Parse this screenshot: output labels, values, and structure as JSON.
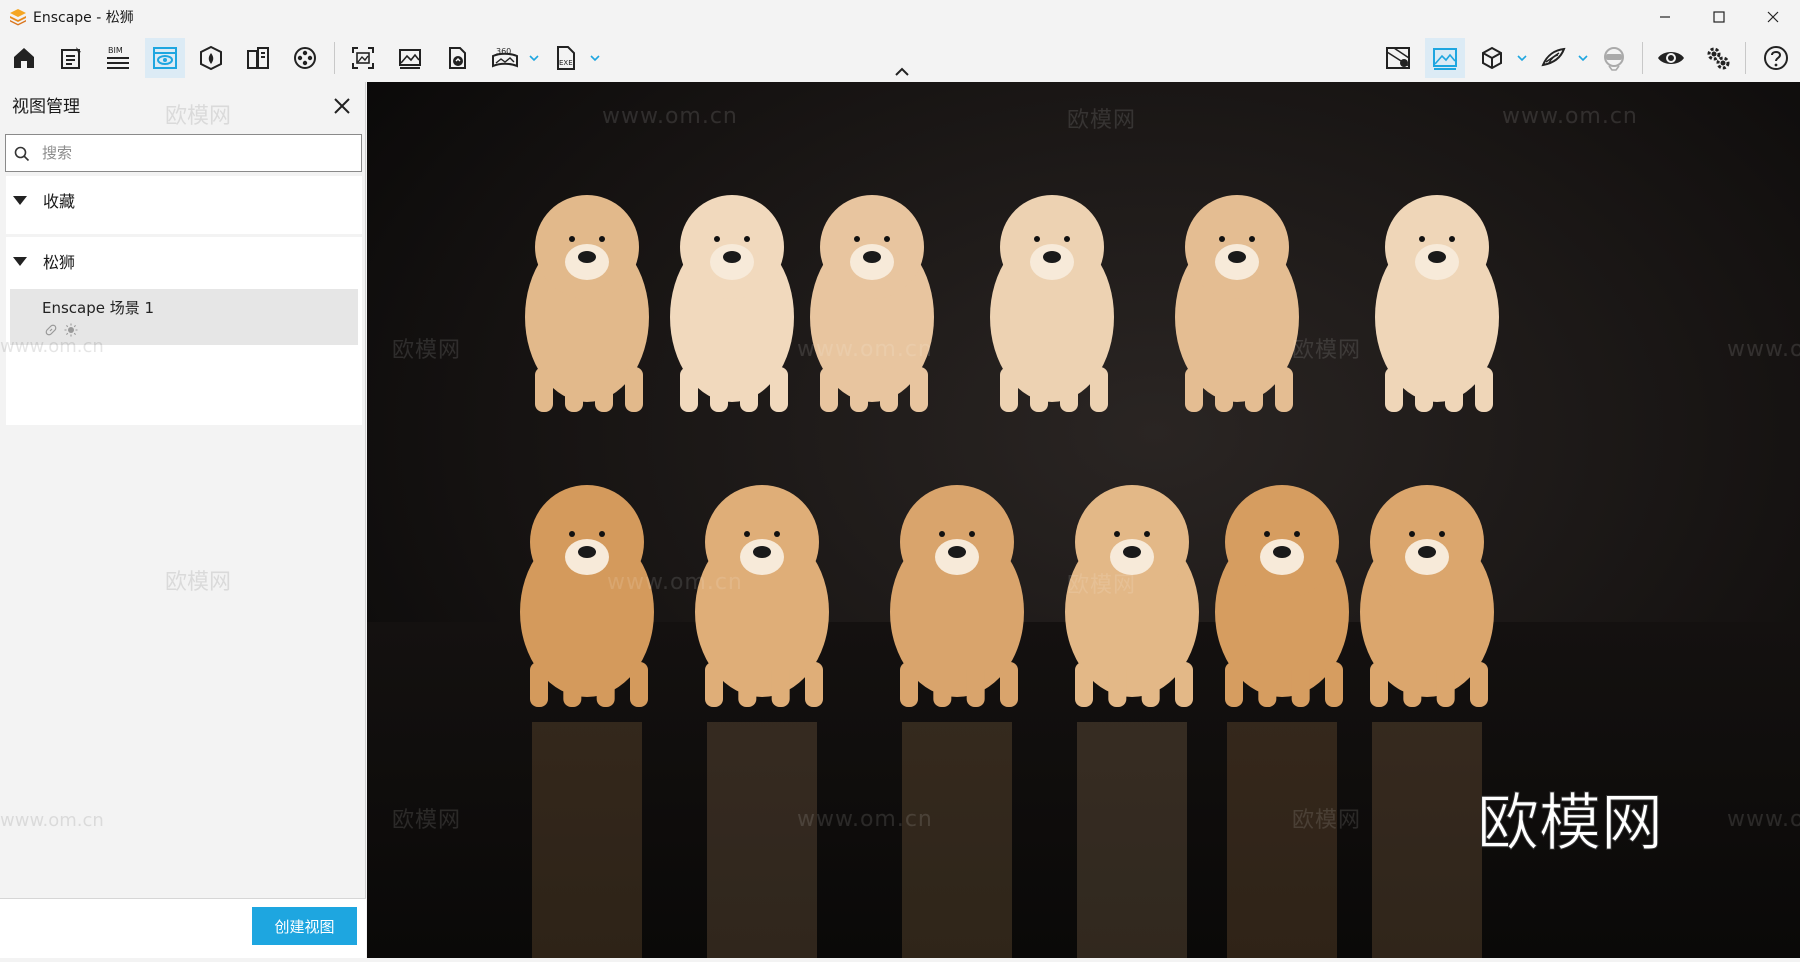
{
  "window": {
    "title": "Enscape - 松狮",
    "logo_icon": "enscape-logo-icon",
    "controls": [
      "minimize-icon",
      "maximize-icon",
      "close-icon"
    ]
  },
  "toolbar": {
    "left_icons": [
      "home-icon",
      "project-notes-icon",
      "bim-icon",
      "view-management-icon",
      "asset-library-icon",
      "material-editor-icon",
      "video-editor-icon",
      "screenshot-icon",
      "batch-render-icon",
      "panorama-upload-icon",
      "panorama-360-icon",
      "exe-export-icon"
    ],
    "bim_label": "BIM",
    "pano_label": "360",
    "exe_label": "EXE",
    "right_icons": [
      "map-view-icon",
      "render-image-icon",
      "cube-view-icon",
      "sun-settings-icon",
      "vr-headset-icon",
      "visual-settings-icon",
      "settings-icon",
      "help-icon"
    ],
    "accent": "#1ea6e0"
  },
  "panel": {
    "title": "视图管理",
    "search_placeholder": "搜索",
    "groups": [
      {
        "label": "收藏"
      },
      {
        "label": "松狮"
      }
    ],
    "view_item": {
      "name": "Enscape 场景 1",
      "icons": [
        "link-icon",
        "sun-icon"
      ]
    },
    "create_button": "创建视图"
  },
  "viewport": {
    "watermarks": [
      "欧模网",
      "www.om.cn"
    ],
    "big_watermark": "欧模网"
  }
}
